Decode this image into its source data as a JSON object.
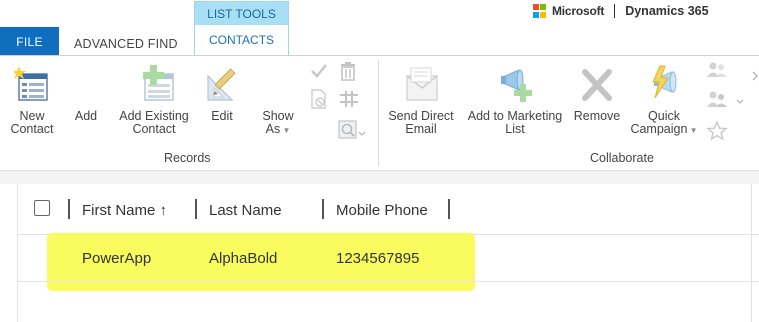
{
  "tabs": {
    "file": "FILE",
    "advanced_find": "ADVANCED FIND",
    "context_group": "LIST TOOLS",
    "context_tab": "CONTACTS"
  },
  "brand": {
    "company": "Microsoft",
    "product": "Dynamics 365"
  },
  "ribbon": {
    "records": {
      "label": "Records",
      "new_contact": "New Contact",
      "add": "Add",
      "add_existing_contact": "Add Existing Contact",
      "edit": "Edit",
      "show_as": "Show As"
    },
    "collaborate": {
      "label": "Collaborate",
      "send_direct_email": "Send Direct Email",
      "add_to_marketing_list": "Add to Marketing List",
      "remove": "Remove",
      "quick_campaign": "Quick Campaign"
    }
  },
  "grid": {
    "columns": [
      "First Name",
      "Last Name",
      "Mobile Phone"
    ],
    "sort_indicator": "↑",
    "rows": [
      {
        "first_name": "PowerApp",
        "last_name": "AlphaBold",
        "mobile_phone": "1234567895"
      }
    ]
  },
  "colors": {
    "file_tab": "#0f6ebd",
    "context_header": "#a8dff4",
    "highlight": "#f9fb55"
  }
}
